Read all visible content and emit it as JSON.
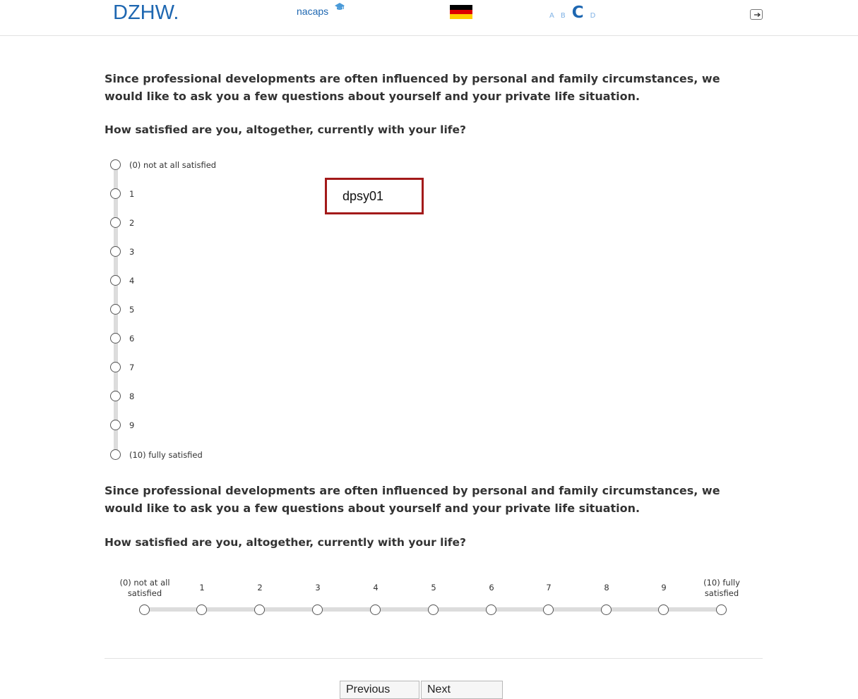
{
  "header": {
    "logo_dzhw": "DZHW.",
    "logo_nacaps": "nacaps",
    "language_flag": "german-flag",
    "font_sizes": [
      "A",
      "B",
      "C",
      "D"
    ],
    "logout_icon": "logout-icon",
    "colors": {
      "brand": "#1e67b1",
      "brand_light": "#7fb2e5"
    }
  },
  "block1": {
    "intro": "Since professional developments are often influenced by personal and family circumstances, we would like to ask you a few questions about yourself and your private life situation.",
    "question": "How satisfied are you, altogether, currently with your life?",
    "options": [
      "(0) not at all satisfied",
      "1",
      "2",
      "3",
      "4",
      "5",
      "6",
      "7",
      "8",
      "9",
      "(10) fully satisfied"
    ]
  },
  "annotation": {
    "label": "dpsy01",
    "border_color": "#a31a1a"
  },
  "block2": {
    "intro": "Since professional developments are often influenced by personal and family circumstances, we would like to ask you a few questions about yourself and your private life situation.",
    "question": "How satisfied are you, altogether, currently with your life?",
    "label_0_line1": "(0) not at all",
    "label_0_line2": "satisfied",
    "middle_labels": [
      "1",
      "2",
      "3",
      "4",
      "5",
      "6",
      "7",
      "8",
      "9"
    ],
    "label_10_line1": "(10) fully",
    "label_10_line2": "satisfied"
  },
  "nav": {
    "previous": "Previous",
    "next": "Next"
  }
}
